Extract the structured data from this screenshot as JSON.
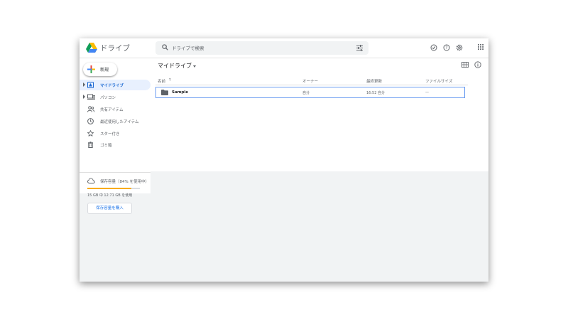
{
  "header": {
    "app_name": "ドライブ",
    "search_placeholder": "ドライブで検索"
  },
  "sidebar": {
    "new_label": "新規",
    "items": [
      {
        "label": "マイドライブ",
        "icon": "my-drive-icon",
        "active": true
      },
      {
        "label": "パソコン",
        "icon": "computer-icon"
      },
      {
        "label": "共有アイテム",
        "icon": "shared-icon"
      },
      {
        "label": "最近使用したアイテム",
        "icon": "clock-icon"
      },
      {
        "label": "スター付き",
        "icon": "star-icon"
      },
      {
        "label": "ゴミ箱",
        "icon": "trash-icon"
      }
    ],
    "storage": {
      "label": "保存容量（84% を使用中）",
      "usage_fraction": 0.84,
      "detail": "15 GB 中 12.71 GB を使用",
      "buy_label": "保存容量を購入"
    }
  },
  "main": {
    "title": "マイドライブ",
    "columns": {
      "name": "名前",
      "sort_arrow": "↑",
      "owner": "オーナー",
      "modified": "最終更新",
      "size": "ファイルサイズ"
    },
    "files": [
      {
        "name": "Sample",
        "owner": "自分",
        "modified": "16:52 自分",
        "size": "—"
      }
    ]
  },
  "colors": {
    "accent": "#1a73e8",
    "active_bg": "#e8f0fe",
    "storage_bar": "#f9ab00"
  }
}
